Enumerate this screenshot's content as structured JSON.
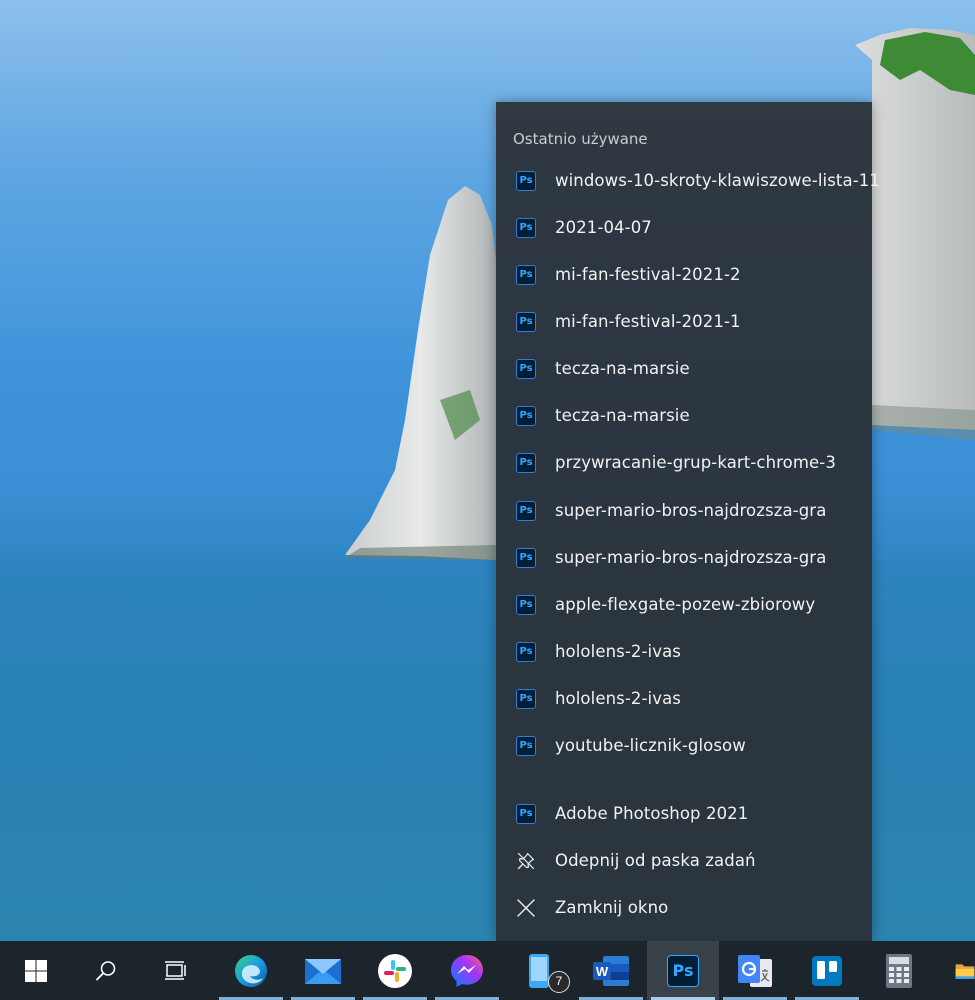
{
  "jumplist": {
    "header": "Ostatnio używane",
    "recent": [
      {
        "label": "windows-10-skroty-klawiszowe-lista-11",
        "icon": "photoshop-icon"
      },
      {
        "label": "2021-04-07",
        "icon": "photoshop-icon"
      },
      {
        "label": "mi-fan-festival-2021-2",
        "icon": "photoshop-icon"
      },
      {
        "label": "mi-fan-festival-2021-1",
        "icon": "photoshop-icon"
      },
      {
        "label": "tecza-na-marsie",
        "icon": "photoshop-icon"
      },
      {
        "label": "tecza-na-marsie",
        "icon": "photoshop-icon"
      },
      {
        "label": "przywracanie-grup-kart-chrome-3",
        "icon": "photoshop-icon"
      },
      {
        "label": "super-mario-bros-najdrozsza-gra",
        "icon": "photoshop-icon"
      },
      {
        "label": "super-mario-bros-najdrozsza-gra",
        "icon": "photoshop-icon"
      },
      {
        "label": "apple-flexgate-pozew-zbiorowy",
        "icon": "photoshop-icon"
      },
      {
        "label": "hololens-2-ivas",
        "icon": "photoshop-icon"
      },
      {
        "label": "hololens-2-ivas",
        "icon": "photoshop-icon"
      },
      {
        "label": "youtube-licznik-glosow",
        "icon": "photoshop-icon"
      }
    ],
    "ps_icon_text": "Ps",
    "tasks": {
      "app_label": "Adobe Photoshop 2021",
      "unpin_label": "Odepnij od paska zadań",
      "close_label": "Zamknij okno"
    }
  },
  "taskbar": {
    "items": [
      {
        "icon": "windows-start-icon"
      },
      {
        "icon": "search-icon"
      },
      {
        "icon": "task-view-icon"
      },
      {
        "icon": "edge-icon"
      },
      {
        "icon": "mail-icon"
      },
      {
        "icon": "slack-icon"
      },
      {
        "icon": "messenger-icon"
      },
      {
        "icon": "phone-icon",
        "badge": "7"
      },
      {
        "icon": "word-icon"
      },
      {
        "icon": "photoshop-icon",
        "active": true
      },
      {
        "icon": "google-translate-icon"
      },
      {
        "icon": "trello-icon"
      },
      {
        "icon": "calculator-icon"
      },
      {
        "icon": "file-explorer-icon"
      }
    ],
    "phone_badge": "7",
    "ps_text": "Ps",
    "word_text": "W"
  },
  "colors": {
    "accent_underline": "#7ab3dd",
    "photoshop_blue": "#31a8ff",
    "taskbar_bg": "#1c252c"
  }
}
